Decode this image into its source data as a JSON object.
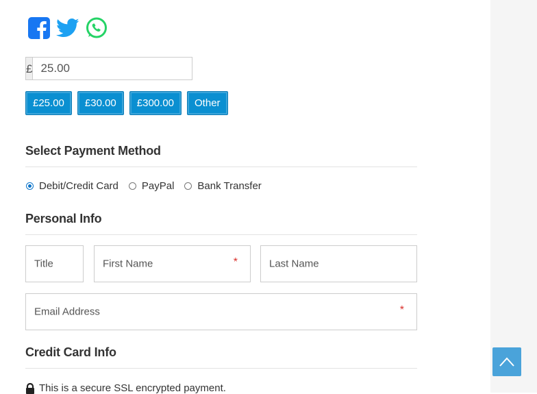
{
  "social": {
    "facebook": "facebook-icon",
    "twitter": "twitter-icon",
    "whatsapp": "whatsapp-icon",
    "colors": {
      "facebook": "#1877f2",
      "twitter": "#1da1f2",
      "whatsapp": "#25d366"
    }
  },
  "amount": {
    "currency_symbol": "£",
    "value": "25.00"
  },
  "presets": [
    "£25.00",
    "£30.00",
    "£300.00",
    "Other"
  ],
  "payment": {
    "title": "Select Payment Method",
    "options": [
      {
        "label": "Debit/Credit Card",
        "checked": true
      },
      {
        "label": "PayPal",
        "checked": false
      },
      {
        "label": "Bank Transfer",
        "checked": false
      }
    ]
  },
  "personal": {
    "title": "Personal Info",
    "title_field": "Title",
    "first_name": "First Name",
    "last_name": "Last Name",
    "email": "Email Address",
    "required_mark": "*"
  },
  "credit": {
    "title": "Credit Card Info",
    "secure_note": "This is a secure SSL encrypted payment."
  },
  "accent_color": "#0a8fd1"
}
